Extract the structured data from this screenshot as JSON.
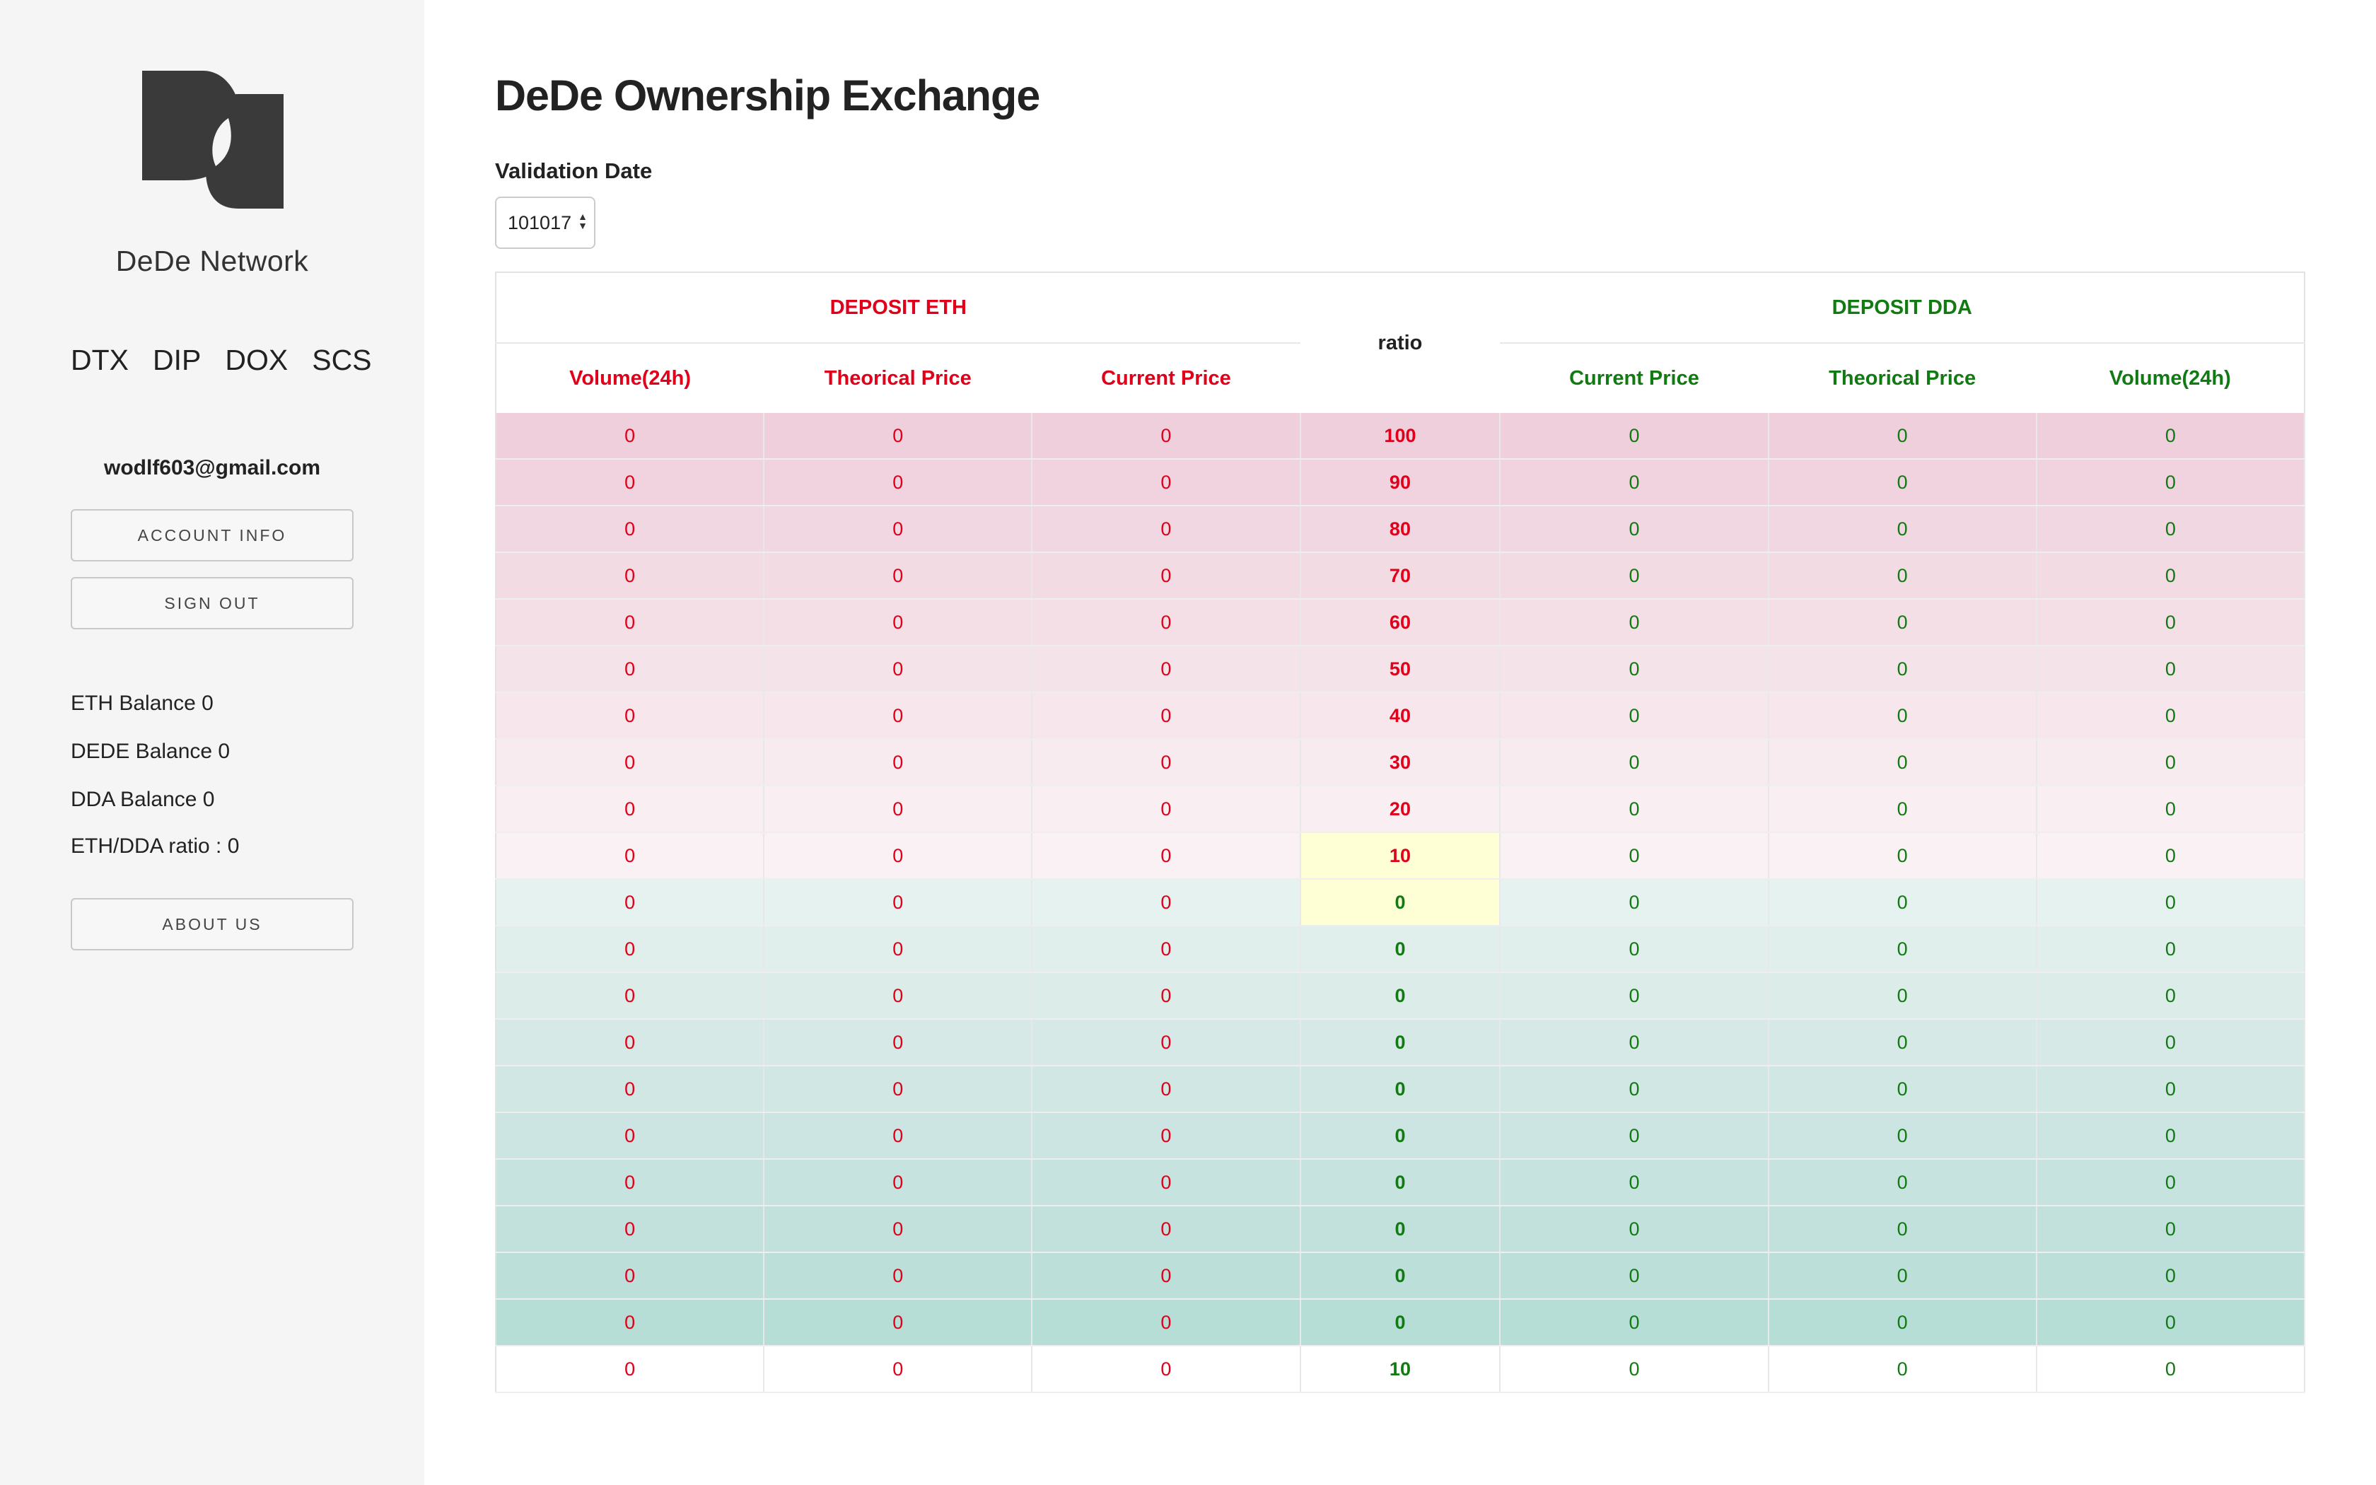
{
  "sidebar": {
    "brand": "DeDe Network",
    "nav": [
      "DTX",
      "DIP",
      "DOX",
      "SCS"
    ],
    "email": "wodlf603@gmail.com",
    "buttons": {
      "account": "ACCOUNT INFO",
      "signout": "SIGN OUT",
      "about": "ABOUT US"
    },
    "balances": {
      "eth": "ETH Balance 0",
      "dede": "DEDE Balance 0",
      "dda": "DDA Balance 0",
      "ratio": "ETH/DDA ratio : 0"
    }
  },
  "main": {
    "title": "DeDe Ownership Exchange",
    "validation_label": "Validation Date",
    "validation_value": "101017"
  },
  "table": {
    "deposit_eth": "DEPOSIT ETH",
    "deposit_dda": "DEPOSIT DDA",
    "ratio_header": "ratio",
    "eth_columns": [
      "Volume(24h)",
      "Theorical Price",
      "Current Price"
    ],
    "dda_columns": [
      "Current Price",
      "Theorical Price",
      "Volume(24h)"
    ],
    "rows": [
      {
        "eth": [
          "0",
          "0",
          "0"
        ],
        "ratio": "100",
        "dda": [
          "0",
          "0",
          "0"
        ],
        "side": "eth",
        "tint": "#efcfdc"
      },
      {
        "eth": [
          "0",
          "0",
          "0"
        ],
        "ratio": "90",
        "dda": [
          "0",
          "0",
          "0"
        ],
        "side": "eth",
        "tint": "#f0d3df"
      },
      {
        "eth": [
          "0",
          "0",
          "0"
        ],
        "ratio": "80",
        "dda": [
          "0",
          "0",
          "0"
        ],
        "side": "eth",
        "tint": "#f1d7e1"
      },
      {
        "eth": [
          "0",
          "0",
          "0"
        ],
        "ratio": "70",
        "dda": [
          "0",
          "0",
          "0"
        ],
        "side": "eth",
        "tint": "#f3dbe4"
      },
      {
        "eth": [
          "0",
          "0",
          "0"
        ],
        "ratio": "60",
        "dda": [
          "0",
          "0",
          "0"
        ],
        "side": "eth",
        "tint": "#f4dfe7"
      },
      {
        "eth": [
          "0",
          "0",
          "0"
        ],
        "ratio": "50",
        "dda": [
          "0",
          "0",
          "0"
        ],
        "side": "eth",
        "tint": "#f5e3ea"
      },
      {
        "eth": [
          "0",
          "0",
          "0"
        ],
        "ratio": "40",
        "dda": [
          "0",
          "0",
          "0"
        ],
        "side": "eth",
        "tint": "#f7e7ed"
      },
      {
        "eth": [
          "0",
          "0",
          "0"
        ],
        "ratio": "30",
        "dda": [
          "0",
          "0",
          "0"
        ],
        "side": "eth",
        "tint": "#f8ebf0"
      },
      {
        "eth": [
          "0",
          "0",
          "0"
        ],
        "ratio": "20",
        "dda": [
          "0",
          "0",
          "0"
        ],
        "side": "eth",
        "tint": "#f9eff3"
      },
      {
        "eth": [
          "0",
          "0",
          "0"
        ],
        "ratio": "10",
        "dda": [
          "0",
          "0",
          "0"
        ],
        "side": "eth",
        "tint": "#faf1f5",
        "highlight": true
      },
      {
        "eth": [
          "0",
          "0",
          "0"
        ],
        "ratio": "0",
        "dda": [
          "0",
          "0",
          "0"
        ],
        "side": "dda",
        "tint": "#e5f2ef",
        "highlight": true
      },
      {
        "eth": [
          "0",
          "0",
          "0"
        ],
        "ratio": "0",
        "dda": [
          "0",
          "0",
          "0"
        ],
        "side": "dda",
        "tint": "#e0efec"
      },
      {
        "eth": [
          "0",
          "0",
          "0"
        ],
        "ratio": "0",
        "dda": [
          "0",
          "0",
          "0"
        ],
        "side": "dda",
        "tint": "#dbece9"
      },
      {
        "eth": [
          "0",
          "0",
          "0"
        ],
        "ratio": "0",
        "dda": [
          "0",
          "0",
          "0"
        ],
        "side": "dda",
        "tint": "#d6e9e6"
      },
      {
        "eth": [
          "0",
          "0",
          "0"
        ],
        "ratio": "0",
        "dda": [
          "0",
          "0",
          "0"
        ],
        "side": "dda",
        "tint": "#d1e7e4"
      },
      {
        "eth": [
          "0",
          "0",
          "0"
        ],
        "ratio": "0",
        "dda": [
          "0",
          "0",
          "0"
        ],
        "side": "dda",
        "tint": "#cce5e2"
      },
      {
        "eth": [
          "0",
          "0",
          "0"
        ],
        "ratio": "0",
        "dda": [
          "0",
          "0",
          "0"
        ],
        "side": "dda",
        "tint": "#c7e3df"
      },
      {
        "eth": [
          "0",
          "0",
          "0"
        ],
        "ratio": "0",
        "dda": [
          "0",
          "0",
          "0"
        ],
        "side": "dda",
        "tint": "#c2e1dc"
      },
      {
        "eth": [
          "0",
          "0",
          "0"
        ],
        "ratio": "0",
        "dda": [
          "0",
          "0",
          "0"
        ],
        "side": "dda",
        "tint": "#bddfda"
      },
      {
        "eth": [
          "0",
          "0",
          "0"
        ],
        "ratio": "0",
        "dda": [
          "0",
          "0",
          "0"
        ],
        "side": "dda",
        "tint": "#b7ddd7"
      },
      {
        "eth": [
          "0",
          "0",
          "0"
        ],
        "ratio": "10",
        "dda": [
          "0",
          "0",
          "0"
        ],
        "side": "dda",
        "tint": "#ffffff"
      }
    ]
  },
  "colors": {
    "eth": "#e0001a",
    "dda": "#127a12",
    "sidebar_bg": "#f5f5f5",
    "highlight": "#ffffd6"
  },
  "icons": {
    "logo": "dede-logo-icon",
    "select_arrows": "updown-arrows-icon"
  }
}
